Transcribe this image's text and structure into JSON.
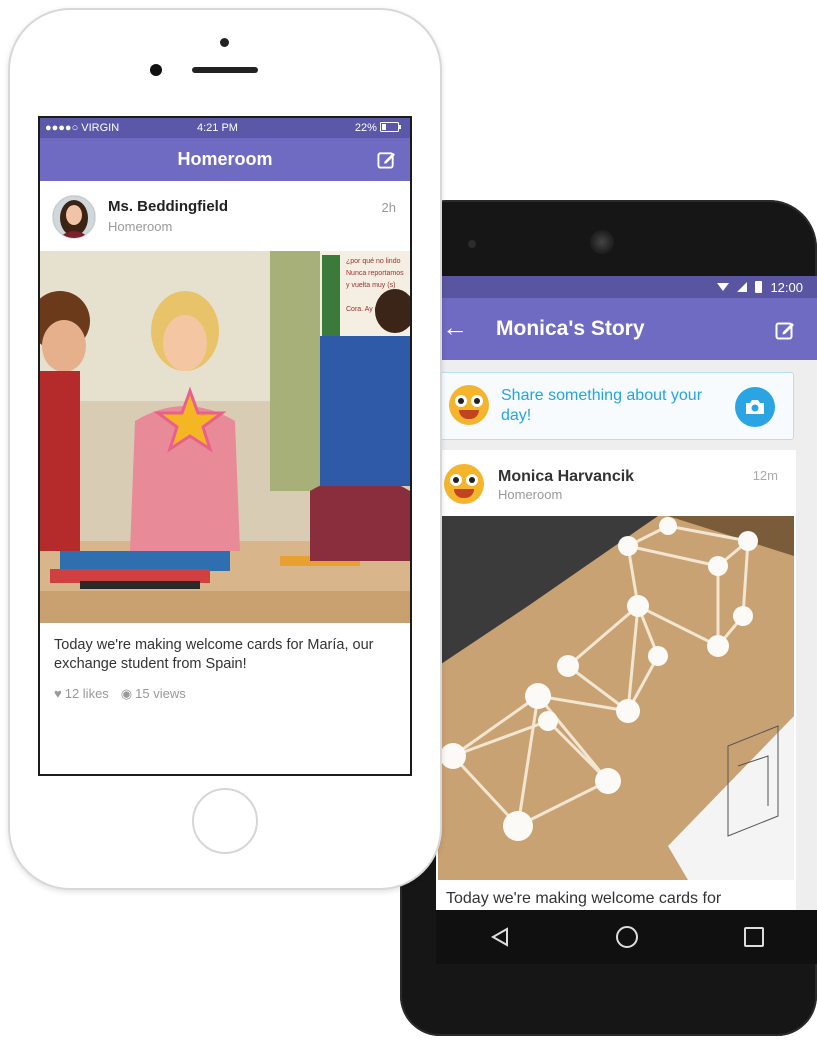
{
  "android": {
    "status": {
      "time": "12:00"
    },
    "appbar": {
      "title": "Monica's Story"
    },
    "share_prompt": "Share something about your day!",
    "post": {
      "author": "Monica Harvancik",
      "class": "Homeroom",
      "time": "12m",
      "caption": "Today we're making welcome cards for"
    },
    "icons": [
      "back-arrow-icon",
      "edit-icon",
      "camera-icon",
      "nav-back-icon",
      "nav-home-icon",
      "nav-recents-icon"
    ]
  },
  "iphone": {
    "status": {
      "carrier": "●●●●○ VIRGIN",
      "time": "4:21 PM",
      "battery": "22%"
    },
    "nav": {
      "title": "Homeroom"
    },
    "post": {
      "author": "Ms. Beddingfield",
      "class": "Homeroom",
      "time": "2h",
      "caption": "Today we're making welcome cards for María, our exchange student from Spain!",
      "likes": "12 likes",
      "views": "15 views"
    }
  },
  "colors": {
    "nav_purple": "#6f6ac2",
    "status_purple": "#5c58a9",
    "accent_blue": "#2aa4e3",
    "monster_yellow": "#f4b42c"
  }
}
